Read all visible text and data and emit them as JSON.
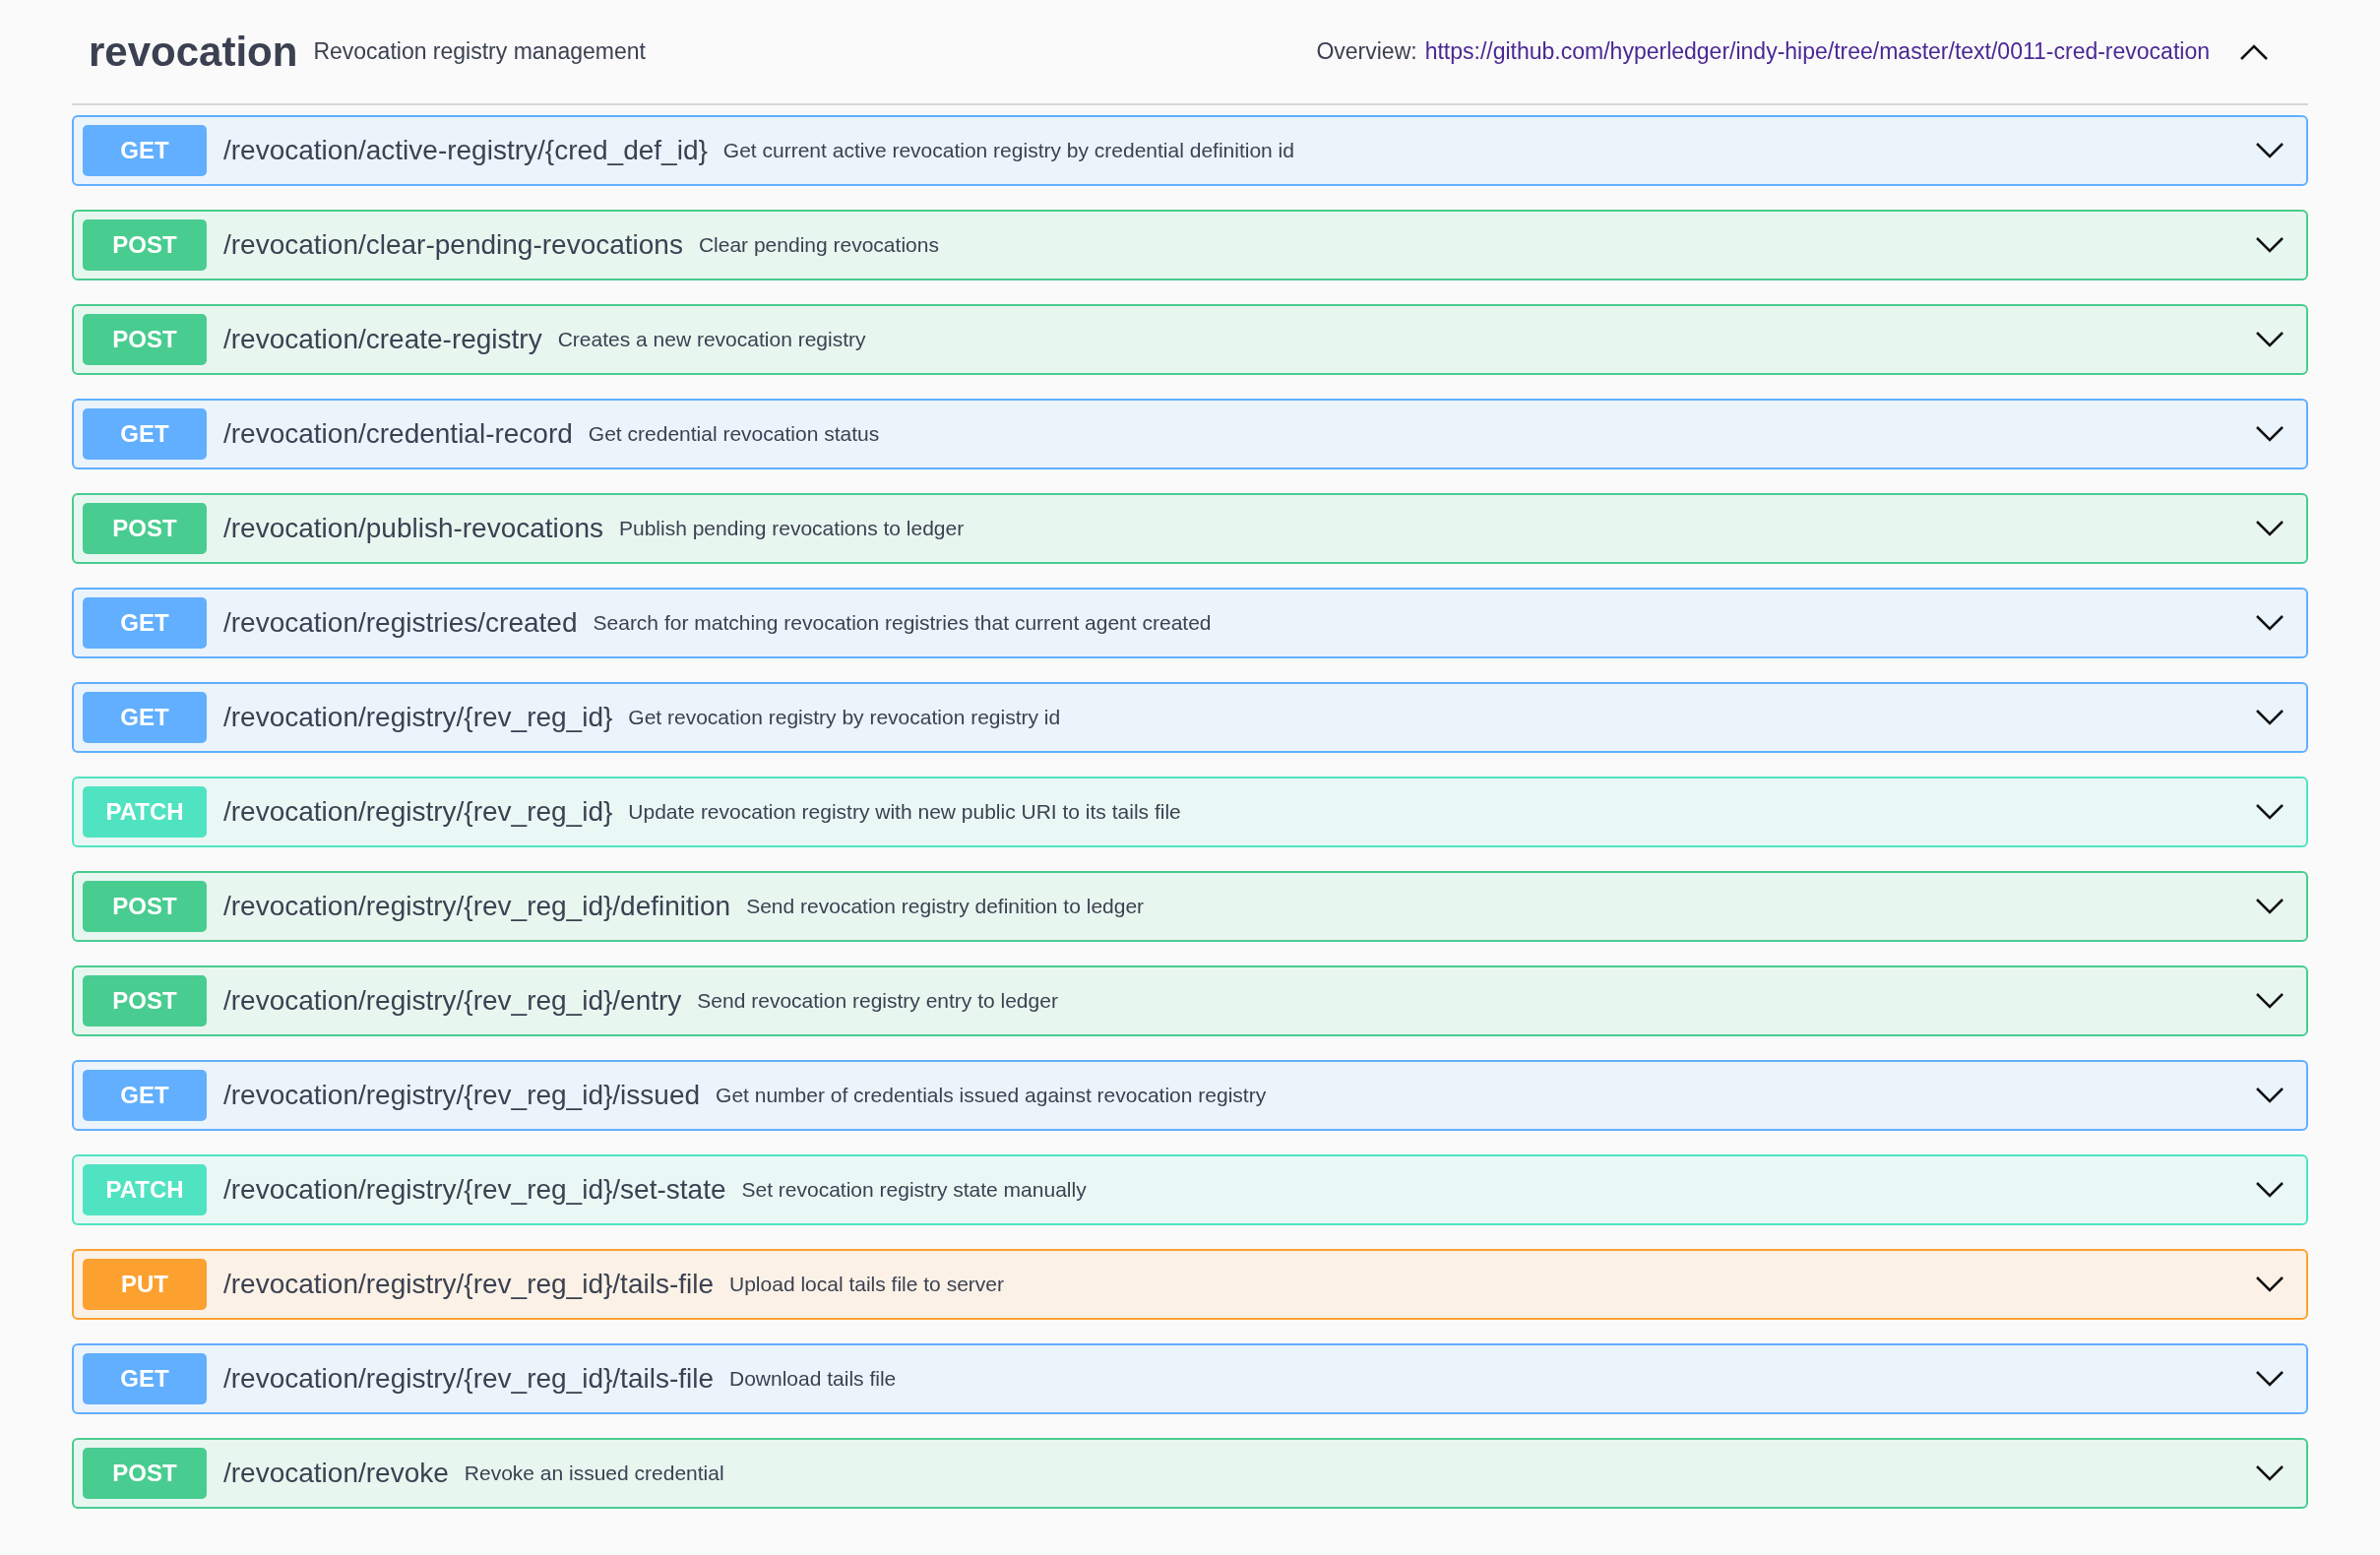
{
  "section": {
    "title": "revocation",
    "description": "Revocation registry management",
    "overview_label": "Overview:",
    "overview_link": "https://github.com/hyperledger/indy-hipe/tree/master/text/0011-cred-revocation",
    "expanded": true
  },
  "operations": [
    {
      "kind": "get",
      "method": "GET",
      "path": "/revocation/active-registry/{cred_def_id}",
      "summary": "Get current active revocation registry by credential definition id"
    },
    {
      "kind": "post",
      "method": "POST",
      "path": "/revocation/clear-pending-revocations",
      "summary": "Clear pending revocations"
    },
    {
      "kind": "post",
      "method": "POST",
      "path": "/revocation/create-registry",
      "summary": "Creates a new revocation registry"
    },
    {
      "kind": "get",
      "method": "GET",
      "path": "/revocation/credential-record",
      "summary": "Get credential revocation status"
    },
    {
      "kind": "post",
      "method": "POST",
      "path": "/revocation/publish-revocations",
      "summary": "Publish pending revocations to ledger"
    },
    {
      "kind": "get",
      "method": "GET",
      "path": "/revocation/registries/created",
      "summary": "Search for matching revocation registries that current agent created"
    },
    {
      "kind": "get",
      "method": "GET",
      "path": "/revocation/registry/{rev_reg_id}",
      "summary": "Get revocation registry by revocation registry id"
    },
    {
      "kind": "patch",
      "method": "PATCH",
      "path": "/revocation/registry/{rev_reg_id}",
      "summary": "Update revocation registry with new public URI to its tails file"
    },
    {
      "kind": "post",
      "method": "POST",
      "path": "/revocation/registry/{rev_reg_id}/definition",
      "summary": "Send revocation registry definition to ledger"
    },
    {
      "kind": "post",
      "method": "POST",
      "path": "/revocation/registry/{rev_reg_id}/entry",
      "summary": "Send revocation registry entry to ledger"
    },
    {
      "kind": "get",
      "method": "GET",
      "path": "/revocation/registry/{rev_reg_id}/issued",
      "summary": "Get number of credentials issued against revocation registry"
    },
    {
      "kind": "patch",
      "method": "PATCH",
      "path": "/revocation/registry/{rev_reg_id}/set-state",
      "summary": "Set revocation registry state manually"
    },
    {
      "kind": "put",
      "method": "PUT",
      "path": "/revocation/registry/{rev_reg_id}/tails-file",
      "summary": "Upload local tails file to server"
    },
    {
      "kind": "get",
      "method": "GET",
      "path": "/revocation/registry/{rev_reg_id}/tails-file",
      "summary": "Download tails file"
    },
    {
      "kind": "post",
      "method": "POST",
      "path": "/revocation/revoke",
      "summary": "Revoke an issued credential"
    }
  ]
}
